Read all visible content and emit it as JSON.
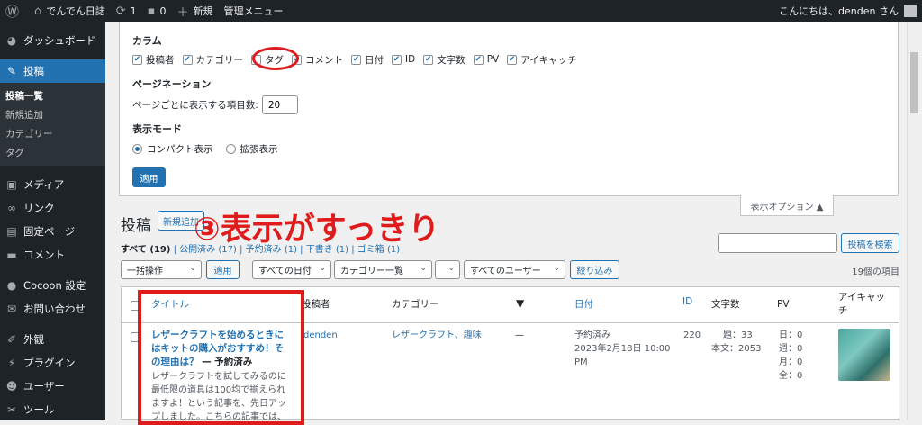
{
  "adminbar": {
    "wp_icon": "wordpress-logo-icon",
    "site_name": "でんでん日誌",
    "updates": "1",
    "comments": "0",
    "new": "新規",
    "admin_menu": "管理メニュー",
    "greeting": "こんにちは、denden さん"
  },
  "sidebar": {
    "items": [
      {
        "icon": "dashboard-icon",
        "label": "ダッシュボード"
      },
      {
        "icon": "pin-icon",
        "label": "投稿"
      },
      {
        "icon": "media-icon",
        "label": "メディア"
      },
      {
        "icon": "link-icon",
        "label": "リンク"
      },
      {
        "icon": "page-icon",
        "label": "固定ページ"
      },
      {
        "icon": "comment-icon",
        "label": "コメント"
      },
      {
        "icon": "cocoon-icon",
        "label": "Cocoon 設定"
      },
      {
        "icon": "mail-icon",
        "label": "お問い合わせ"
      },
      {
        "icon": "brush-icon",
        "label": "外観"
      },
      {
        "icon": "plugin-icon",
        "label": "プラグイン"
      },
      {
        "icon": "user-icon",
        "label": "ユーザー"
      },
      {
        "icon": "wrench-icon",
        "label": "ツール"
      }
    ],
    "submenu": [
      "投稿一覧",
      "新規追加",
      "カテゴリー",
      "タグ"
    ]
  },
  "screen_options": {
    "columns_heading": "カラム",
    "columns": [
      {
        "label": "投稿者",
        "checked": true
      },
      {
        "label": "カテゴリー",
        "checked": true
      },
      {
        "label": "タグ",
        "checked": false
      },
      {
        "label": "コメント",
        "checked": true
      },
      {
        "label": "日付",
        "checked": true
      },
      {
        "label": "ID",
        "checked": true
      },
      {
        "label": "文字数",
        "checked": true
      },
      {
        "label": "PV",
        "checked": true
      },
      {
        "label": "アイキャッチ",
        "checked": true
      }
    ],
    "pagination_heading": "ページネーション",
    "per_page_label": "ページごとに表示する項目数:",
    "per_page_value": "20",
    "mode_heading": "表示モード",
    "mode_compact": "コンパクト表示",
    "mode_extended": "拡張表示",
    "apply": "適用",
    "tab_label": "表示オプション ▲"
  },
  "annotation": "③表示がすっきり",
  "page": {
    "title": "投稿",
    "add_new": "新規追加"
  },
  "subsub": {
    "all": "すべて (19)",
    "published": "公開済み (17)",
    "scheduled": "予約済み (1)",
    "draft": "下書き (1)",
    "trash": "ゴミ箱 (1)"
  },
  "search_button": "投稿を検索",
  "filters": {
    "bulk": "一括操作",
    "apply": "適用",
    "dates": "すべての日付",
    "categories": "カテゴリー一覧",
    "users": "すべてのユーザー",
    "filter": "絞り込み",
    "items": "19個の項目"
  },
  "table": {
    "headers": {
      "title": "タイトル",
      "author": "投稿者",
      "category": "カテゴリー",
      "date": "日付",
      "id": "ID",
      "chars": "文字数",
      "pv": "PV",
      "thumb1": "アイキャッ",
      "thumb2": "チ"
    },
    "row": {
      "title": "レザークラフトを始めるときにはキットの購入がおすすめ！その理由は？",
      "state": "— 予約済み",
      "excerpt": "レザークラフトを試してみるのに最低限の道具は100均で揃えられますよ！という記事を、先日アップしました。こちらの記事では、",
      "author": "denden",
      "category": "レザークラフト、趣味",
      "comments": "—",
      "status": "予約済み",
      "date": "2023年2月18日 10:00",
      "time": "PM",
      "id": "220",
      "chars_title": "題：33",
      "chars_body": "本文：2053",
      "pv_day": "日：0",
      "pv_week": "週：0",
      "pv_month": "月：0",
      "pv_all": "全：0"
    }
  },
  "colors": {
    "accent": "#2271b1",
    "annotation": "#e01b1b",
    "adminbar": "#1d2327"
  }
}
